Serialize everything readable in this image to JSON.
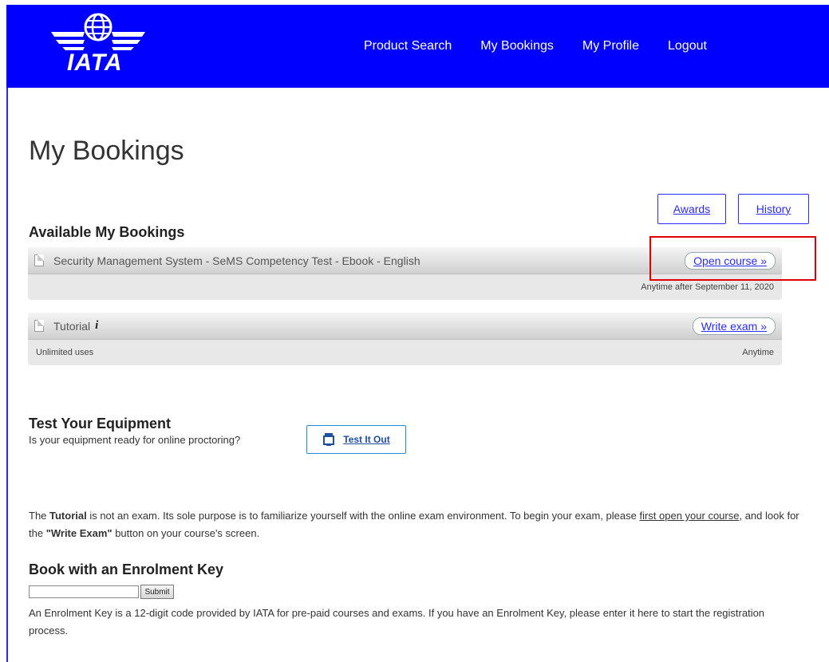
{
  "header": {
    "logo_text": "IATA",
    "nav": [
      {
        "label": "Product Search"
      },
      {
        "label": "My Bookings"
      },
      {
        "label": "My Profile"
      },
      {
        "label": "Logout"
      }
    ]
  },
  "page": {
    "title": "My Bookings",
    "buttons": {
      "awards": "Awards",
      "history": "History"
    }
  },
  "bookings": {
    "section_title": "Available My Bookings",
    "items": [
      {
        "title": "Security Management System - SeMS Competency Test - Ebook - English",
        "action": "Open course »",
        "left_note": "",
        "right_note": "Anytime after September 11, 2020"
      },
      {
        "title": "Tutorial",
        "action": "Write exam »",
        "left_note": "Unlimited uses",
        "right_note": "Anytime"
      }
    ]
  },
  "equipment": {
    "title": "Test Your Equipment",
    "question": "Is your equipment ready for online proctoring?",
    "button": "Test It Out"
  },
  "tutorial_note": {
    "prefix": "The ",
    "bold1": "Tutorial",
    "middle": " is not an exam. Its sole purpose is to familiarize yourself with the online exam environment. To begin your exam, please ",
    "link": "first open your course",
    "mid2": ", and look for the ",
    "bold2": "\"Write Exam\"",
    "suffix": " button on your course's screen."
  },
  "enrolment": {
    "title": "Book with an Enrolment Key",
    "input_value": "",
    "submit": "Submit",
    "description": "An Enrolment Key is a 12-digit code provided by IATA for pre-paid courses and exams. If you have an Enrolment Key, please enter it here to start the registration process."
  },
  "colors": {
    "header_bg": "#0000ff",
    "accent": "#2b2bff",
    "highlight": "#e00000"
  }
}
